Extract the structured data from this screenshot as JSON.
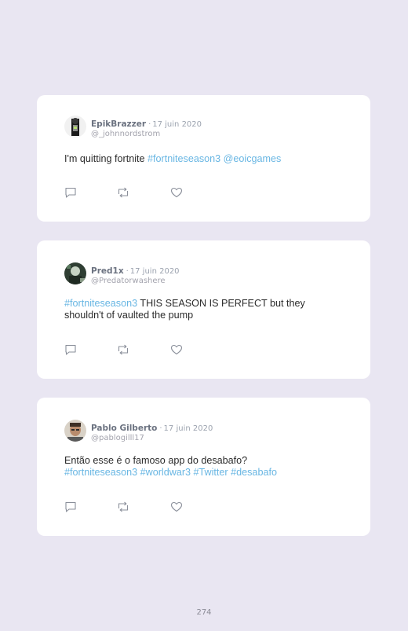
{
  "tweets": [
    {
      "display_name": "EpikBrazzer",
      "separator": "·",
      "date": "17 juin 2020",
      "handle": "@_johnnordstrom",
      "body_segments": [
        {
          "text": "I'm quitting fortnite ",
          "type": "text"
        },
        {
          "text": "#fortniteseason3",
          "type": "tag"
        },
        {
          "text": " ",
          "type": "text"
        },
        {
          "text": "@eoicgames",
          "type": "tag"
        }
      ]
    },
    {
      "display_name": "Pred1x",
      "separator": "·",
      "date": "17 juin 2020",
      "handle": "@Predatorwashere",
      "body_segments": [
        {
          "text": "#fortniteseason3",
          "type": "tag"
        },
        {
          "text": " THIS SEASON IS PERFECT but they shouldn't of vaulted the pump",
          "type": "text"
        }
      ]
    },
    {
      "display_name": "Pablo Gilberto",
      "separator": "·",
      "date": "17 juin 2020",
      "handle": "@pablogilll17",
      "body_segments": [
        {
          "text": "Então esse é o famoso app do desabafo?",
          "type": "text"
        },
        {
          "text": "#fortniteseason3",
          "type": "tag"
        },
        {
          "text": " ",
          "type": "text"
        },
        {
          "text": "#worldwar3",
          "type": "tag"
        },
        {
          "text": " ",
          "type": "text"
        },
        {
          "text": "#Twitter",
          "type": "tag"
        },
        {
          "text": " ",
          "type": "text"
        },
        {
          "text": "#desabafo",
          "type": "tag"
        }
      ]
    }
  ],
  "icons": {
    "reply": "speech-bubble-icon",
    "retweet": "retweet-arrows-icon",
    "like": "heart-icon"
  },
  "colors": {
    "background": "#e9e6f2",
    "card": "#ffffff",
    "link": "#68b6e3",
    "text": "#2b2b2b",
    "muted": "#9ca3af"
  },
  "page_number": "274"
}
